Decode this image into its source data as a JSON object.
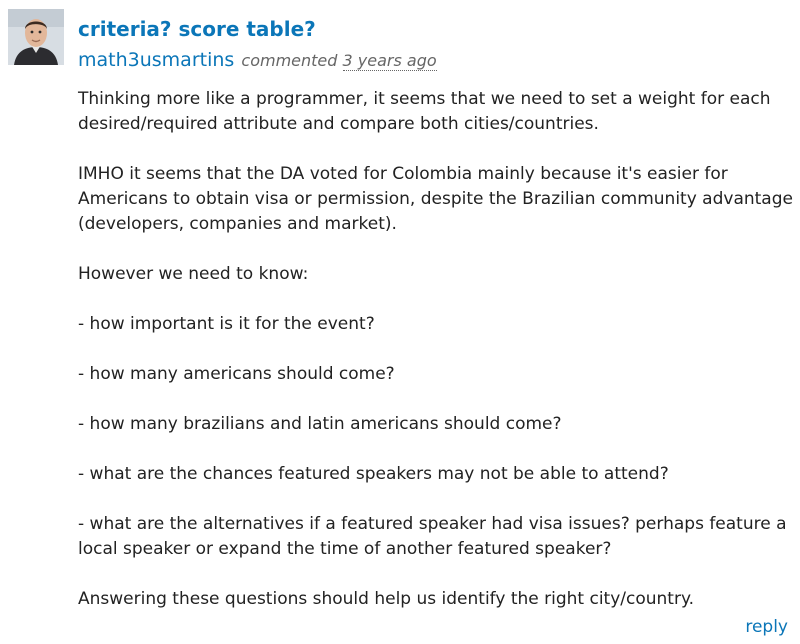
{
  "comment": {
    "title": "criteria? score table?",
    "author": "math3usmartins",
    "action": "commented",
    "time": "3 years ago",
    "paragraphs": [
      "Thinking more like a programmer, it seems that we need to set a weight for each desired/required attribute and compare both cities/countries.",
      "IMHO it seems that the DA voted for Colombia mainly because it's easier for Americans to obtain visa or permission, despite the Brazilian community advantage (developers, companies and market).",
      "However we need to know:",
      "- how important is it for the event?",
      "- how many americans should come?",
      "- how many brazilians and latin americans should come?",
      "- what are the chances featured speakers may not be able to attend?",
      "- what are the alternatives if a featured speaker had visa issues? perhaps feature a local speaker or expand the time of another featured speaker?",
      "Answering these questions should help us identify the right city/country."
    ],
    "reply_label": "reply"
  },
  "colors": {
    "link": "#0b76b8",
    "text": "#222222",
    "muted": "#666666"
  }
}
